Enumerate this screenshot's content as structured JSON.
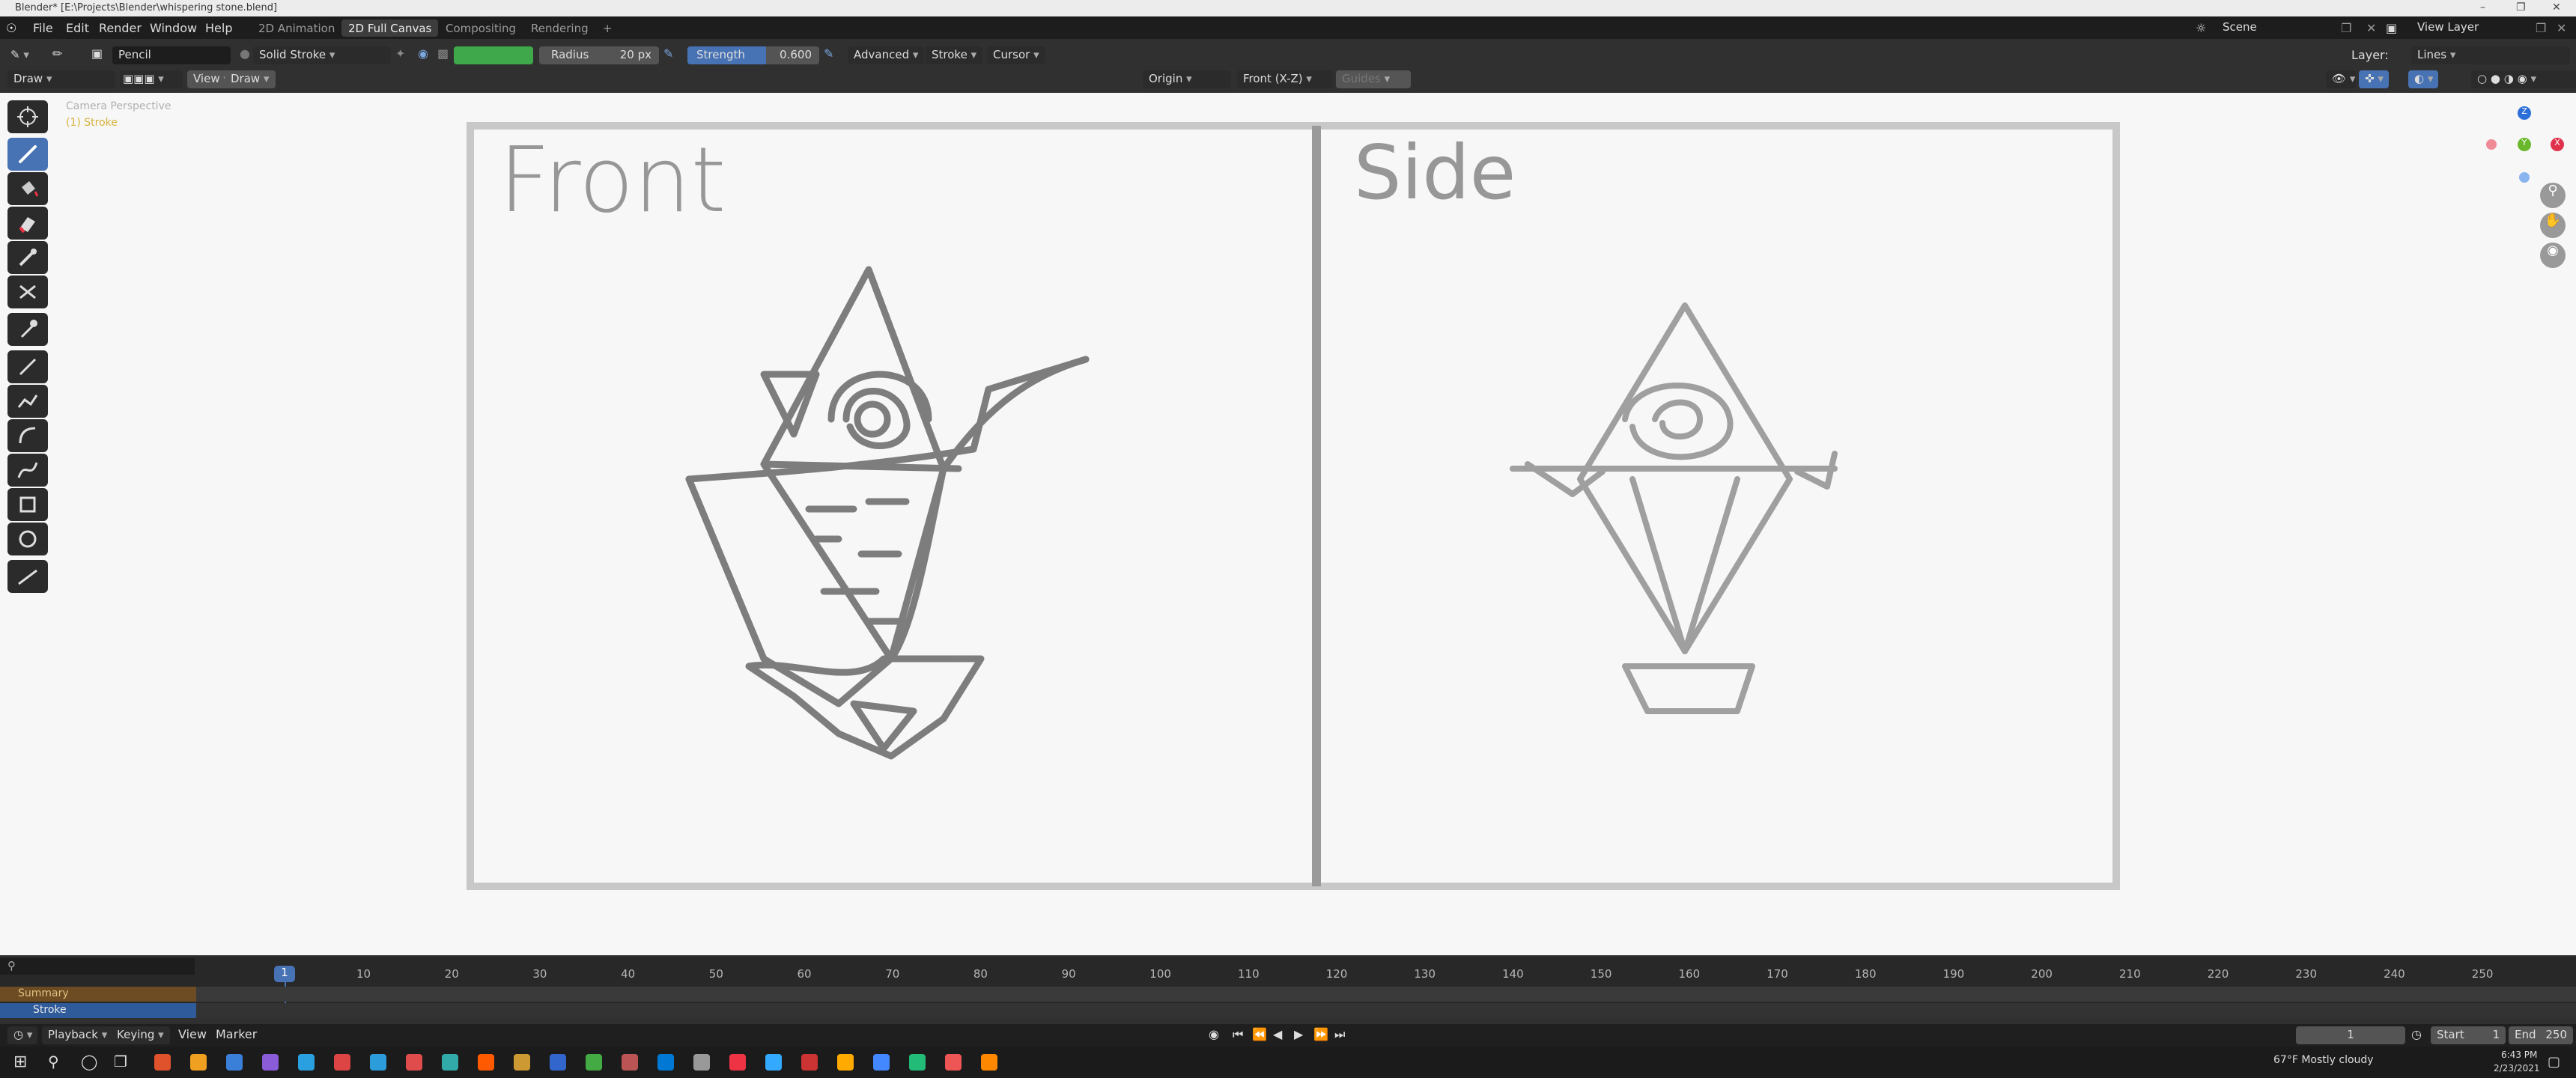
{
  "titlebar": {
    "title": "Blender* [E:\\Projects\\Blender\\whispering stone.blend]"
  },
  "menu": {
    "items": [
      "File",
      "Edit",
      "Render",
      "Window",
      "Help"
    ]
  },
  "workspaces": [
    "2D Animation",
    "2D Full Canvas",
    "Compositing",
    "Rendering"
  ],
  "active_workspace": "2D Full Canvas",
  "scene": {
    "label": "Scene",
    "view_layer": "View Layer"
  },
  "tool_header": {
    "mode": "Draw",
    "brush": "Pencil",
    "stroke_type": "Solid Stroke",
    "radius_label": "Radius",
    "radius_value": "20 px",
    "strength_label": "Strength",
    "strength_value": "0.600",
    "advanced": "Advanced",
    "stroke": "Stroke",
    "cursor": "Cursor",
    "layer_label": "Layer:",
    "layer_value": "Lines",
    "color": "#3fa84a"
  },
  "view_header": {
    "mode": "Draw",
    "view": "View",
    "draw": "Draw",
    "origin": "Origin",
    "axis": "Front (X-Z)",
    "guides": "Guides"
  },
  "viewport": {
    "camera_label": "Camera Perspective",
    "stroke_label": "(1) Stroke",
    "front_text": "Front",
    "side_text": "Side"
  },
  "navgizmo": {
    "z": "Z",
    "y": "Y",
    "x": "X"
  },
  "timeline": {
    "ticks": [
      "10",
      "20",
      "30",
      "40",
      "50",
      "60",
      "70",
      "80",
      "90",
      "100",
      "110",
      "120",
      "130",
      "140",
      "150",
      "160",
      "170",
      "180",
      "190",
      "200",
      "210",
      "220",
      "230",
      "240",
      "250"
    ],
    "current_frame": "1",
    "tracks": [
      "Summary",
      "Stroke"
    ],
    "footer": [
      "Playback",
      "Keying",
      "View",
      "Marker"
    ],
    "frame_field": "1",
    "start_label": "Start",
    "start_value": "1",
    "end_label": "End",
    "end_value": "250"
  },
  "taskbar": {
    "weather": "67°F  Mostly cloudy",
    "time": "6:43 PM",
    "date": "2/23/2021"
  }
}
